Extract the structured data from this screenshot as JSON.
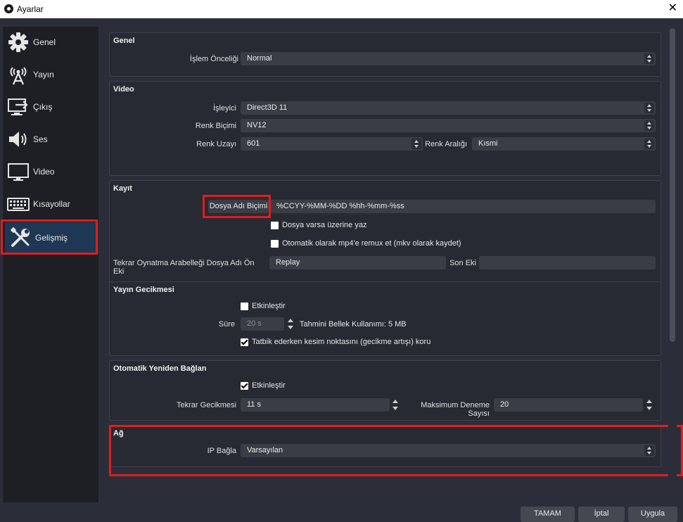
{
  "window": {
    "title": "Ayarlar",
    "close_glyph": "✕"
  },
  "sidebar": {
    "items": [
      {
        "label": "Genel",
        "icon": "gear-icon"
      },
      {
        "label": "Yayın",
        "icon": "broadcast-icon"
      },
      {
        "label": "Çıkış",
        "icon": "output-icon"
      },
      {
        "label": "Ses",
        "icon": "speaker-icon"
      },
      {
        "label": "Video",
        "icon": "monitor-icon"
      },
      {
        "label": "Kısayollar",
        "icon": "keyboard-icon"
      },
      {
        "label": "Gelişmiş",
        "icon": "tools-icon",
        "selected": true
      }
    ]
  },
  "general": {
    "title": "Genel",
    "process_priority_label": "İşlem Önceliği",
    "process_priority_value": "Normal"
  },
  "video": {
    "title": "Video",
    "renderer_label": "İşleyici",
    "renderer_value": "Direct3D 11",
    "color_format_label": "Renk Biçimi",
    "color_format_value": "NV12",
    "color_space_label": "Renk Uzayı",
    "color_space_value": "601",
    "color_range_label": "Renk Aralığı",
    "color_range_value": "Kısmi"
  },
  "recording": {
    "title": "Kayıt",
    "filename_format_label": "Dosya Adı Biçimi",
    "filename_format_value": "%CCYY-%MM-%DD %hh-%mm-%ss",
    "overwrite_label": "Dosya varsa üzerine yaz",
    "overwrite_checked": false,
    "remux_label": "Otomatik olarak mp4'e remux et (mkv olarak kaydet)",
    "remux_checked": false,
    "replay_prefix_label": "Tekrar Oynatma Arabelleği Dosya Adı Ön Eki",
    "replay_prefix_value": "Replay",
    "suffix_label": "Son Eki",
    "suffix_value": ""
  },
  "stream_delay": {
    "title": "Yayın Gecikmesi",
    "enable_label": "Etkinleştir",
    "enable_checked": false,
    "duration_label": "Süre",
    "duration_value": "20 s",
    "memory_text": "Tahmini Bellek Kullanımı: 5 MB",
    "preserve_label": "Tatbik ederken kesim noktasını (gecikme artışı) koru",
    "preserve_checked": true
  },
  "reconnect": {
    "title": "Otomatik Yeniden Bağlan",
    "enable_label": "Etkinleştir",
    "enable_checked": true,
    "retry_delay_label": "Tekrar Gecikmesi",
    "retry_delay_value": "11 s",
    "max_retries_label": "Maksimum Deneme Sayısı",
    "max_retries_value": "20"
  },
  "network": {
    "title": "Ağ",
    "bind_ip_label": "IP Bağla",
    "bind_ip_value": "Varsayılan"
  },
  "buttons": {
    "ok": "TAMAM",
    "cancel": "İptal",
    "apply": "Uygula"
  },
  "colors": {
    "highlight": "#e21c1c",
    "selected_nav": "#1d3754",
    "background": "#2b2e38"
  }
}
